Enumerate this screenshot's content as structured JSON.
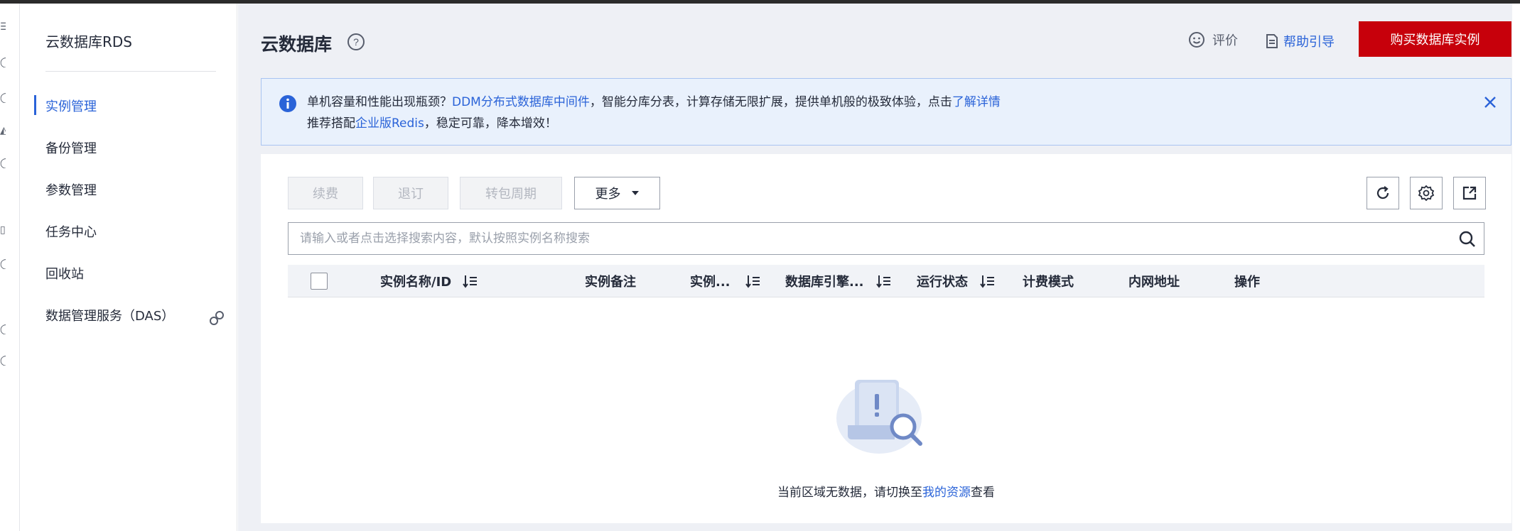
{
  "sidebar": {
    "title": "云数据库RDS",
    "items": [
      {
        "label": "实例管理",
        "active": true
      },
      {
        "label": "备份管理"
      },
      {
        "label": "参数管理"
      },
      {
        "label": "任务中心"
      },
      {
        "label": "回收站"
      },
      {
        "label": "数据管理服务（DAS）"
      }
    ]
  },
  "header": {
    "title": "云数据库",
    "rate_label": "评价",
    "guide_label": "帮助引导",
    "buy_label": "购买数据库实例"
  },
  "notice": {
    "line1_prefix": "单机容量和性能出现瓶颈？",
    "line1_link1": "DDM分布式数据库中间件",
    "line1_middle": "，智能分库分表，计算存储无限扩展，提供单机般的极致体验，点击",
    "line1_link2": "了解详情",
    "line2_prefix": "推荐搭配",
    "line2_link": "企业版Redis",
    "line2_suffix": "，稳定可靠，降本增效！"
  },
  "toolbar": {
    "renew_label": "续费",
    "unsubscribe_label": "退订",
    "to_periodic_label": "转包周期",
    "more_label": "更多"
  },
  "search": {
    "placeholder": "请输入或者点击选择搜索内容，默认按照实例名称搜索"
  },
  "table": {
    "columns": [
      "实例名称/ID",
      "实例备注",
      "实例...",
      "数据库引擎...",
      "运行状态",
      "计费模式",
      "内网地址",
      "操作"
    ]
  },
  "empty": {
    "prefix": "当前区域无数据，请切换至",
    "link": "我的资源",
    "suffix": "查看"
  },
  "colors": {
    "accent": "#2a63d8",
    "buy_button": "#c7000b",
    "notice_bg": "#e9f1fc"
  }
}
